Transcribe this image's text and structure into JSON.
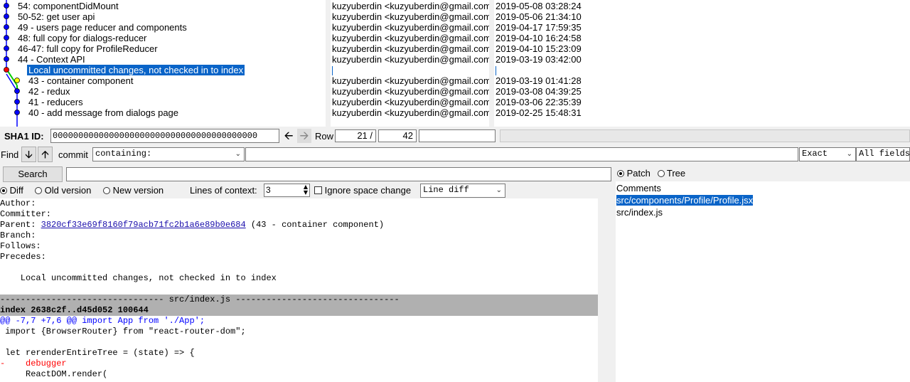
{
  "commits": [
    {
      "msg": "54: componentDidMount",
      "author": "kuzyuberdin <kuzyuberdin@gmail.com>",
      "date": "2019-05-08 03:28:24"
    },
    {
      "msg": "50-52: get user api",
      "author": "kuzyuberdin <kuzyuberdin@gmail.com>",
      "date": "2019-05-06 21:34:10"
    },
    {
      "msg": "49 - users page reducer and components",
      "author": "kuzyuberdin <kuzyuberdin@gmail.com>",
      "date": "2019-04-17 17:59:35"
    },
    {
      "msg": "48: full copy for dialogs-reducer",
      "author": "kuzyuberdin <kuzyuberdin@gmail.com>",
      "date": "2019-04-10 16:24:58"
    },
    {
      "msg": "46-47: full copy for ProfileReducer",
      "author": "kuzyuberdin <kuzyuberdin@gmail.com>",
      "date": "2019-04-10 15:23:09"
    },
    {
      "msg": "44 - Context API",
      "author": "kuzyuberdin <kuzyuberdin@gmail.com>",
      "date": "2019-03-19 03:42:00"
    },
    {
      "msg": "Local uncommitted changes, not checked in to index",
      "author": "",
      "date": ""
    },
    {
      "msg": "43 - container component",
      "author": "kuzyuberdin <kuzyuberdin@gmail.com>",
      "date": "2019-03-19 01:41:28"
    },
    {
      "msg": "42 - redux",
      "author": "kuzyuberdin <kuzyuberdin@gmail.com>",
      "date": "2019-03-08 04:39:25"
    },
    {
      "msg": "41 - reducers",
      "author": "kuzyuberdin <kuzyuberdin@gmail.com>",
      "date": "2019-03-06 22:35:39"
    },
    {
      "msg": "40 - add message from dialogs page",
      "author": "kuzyuberdin <kuzyuberdin@gmail.com>",
      "date": "2019-02-25 15:48:31"
    }
  ],
  "sha": {
    "label": "SHA1 ID:",
    "value": "0000000000000000000000000000000000000000",
    "back_icon": "arrow-left-icon",
    "forward_icon": "arrow-right-icon"
  },
  "row": {
    "label": "Row",
    "current": "21 /",
    "total": "42"
  },
  "find": {
    "label": "Find",
    "down_icon": "arrow-down-icon",
    "up_icon": "arrow-up-icon",
    "commit_label": "commit",
    "mode": "containing:",
    "match": "Exact",
    "fields": "All fields"
  },
  "search": {
    "button": "Search"
  },
  "view": {
    "patch": "Patch",
    "tree": "Tree"
  },
  "diffopts": {
    "diff": "Diff",
    "old": "Old version",
    "new": "New version",
    "context_label": "Lines of context:",
    "context_value": "3",
    "ignore_space": "Ignore space change",
    "diff_mode": "Line diff"
  },
  "meta": {
    "author": "Author:",
    "committer": "Committer:",
    "parent_label": "Parent:",
    "parent_sha": "3820cf33e69f8160f79acb71fc2b1a6e89b0e684",
    "parent_desc": "(43 - container component)",
    "branch": "Branch:",
    "follows": "Follows:",
    "precedes": "Precedes:",
    "message": "    Local uncommitted changes, not checked in to index"
  },
  "diff": {
    "file_header": "-------------------------------- src/index.js --------------------------------",
    "index_line": "index 2638c2f..d45d052 100644",
    "hunk": "@@ -7,7 +7,6 @@ import App from './App';",
    "lines": [
      {
        "text": " import {BrowserRouter} from \"react-router-dom\";",
        "kind": "ctx"
      },
      {
        "text": "",
        "kind": "ctx"
      },
      {
        "text": " let rerenderEntireTree = (state) => {",
        "kind": "ctx"
      },
      {
        "text": "-    debugger",
        "kind": "del"
      },
      {
        "text": "     ReactDOM.render(",
        "kind": "ctx"
      }
    ]
  },
  "files": {
    "items": [
      "Comments",
      "src/components/Profile/Profile.jsx",
      "src/index.js"
    ]
  },
  "colors": {
    "selection": "#0a64c8",
    "graph_line": "#00cc00",
    "node": "#0000ff",
    "local_node": "#ff0000",
    "index_node": "#ffff00",
    "del": "#ff0000",
    "hunk": "#0000ff",
    "header_bg": "#b0b0b0"
  }
}
